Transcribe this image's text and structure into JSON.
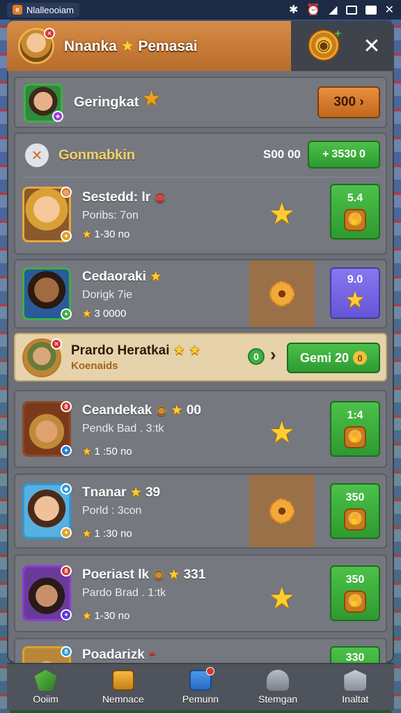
{
  "status_bar": {
    "app_title": "Nlalleooiam",
    "icons": [
      "bluetooth-icon",
      "alarm-icon",
      "signal-icon",
      "window-icon",
      "window-icon",
      "close-icon"
    ]
  },
  "header": {
    "title_part1": "Nnanka",
    "title_part2": "Pemasai",
    "close_symbol": "✕"
  },
  "top_row": {
    "name": "Geringkat",
    "button_label": "300",
    "button_arrow": "›"
  },
  "section": {
    "name": "Gonmabkin",
    "value": "S00 00",
    "button_label": "3530",
    "button_prefix": "+",
    "button_suffix": "0"
  },
  "players": [
    {
      "name": "Sestedd: lr",
      "sub": "Poribs: 7on",
      "meta": "1-30 no",
      "btn_value": "5.4",
      "btn_color": "green",
      "mid": "star"
    },
    {
      "name": "Cedaoraki",
      "sub": "Dorigk 7ie",
      "meta": "3 0000",
      "btn_value": "9.0",
      "btn_color": "purple",
      "mid": "gear"
    },
    {
      "name": "Ceandekak",
      "sub": "Pendk Bad . 3:tk",
      "meta": "1 :50 no",
      "btn_value": "1:4",
      "btn_color": "green",
      "mid": "star",
      "extra": "00"
    },
    {
      "name": "Tnanar",
      "sub": "Porld : 3con",
      "meta": "1 :30 no",
      "btn_value": "350",
      "btn_color": "green",
      "mid": "gear",
      "extra": "39"
    },
    {
      "name": "Poeriast lk",
      "sub": "Pardo Brad . 1:tk",
      "meta": "1-30 no",
      "btn_value": "350",
      "btn_color": "green",
      "mid": "star",
      "extra": "331"
    },
    {
      "name": "Poadarizk",
      "btn_value": "330",
      "btn_color": "green"
    }
  ],
  "highlight_row": {
    "name": "Prardo Heratkai",
    "sub": "Koenaids",
    "toggle_symbol": "0",
    "arrow": "›",
    "button_label": "Gemi 20",
    "button_suffix": "0"
  },
  "bottom_nav": [
    {
      "label": "Ooiim",
      "icon": "shield-icon"
    },
    {
      "label": "Nemnace",
      "icon": "trophy-icon"
    },
    {
      "label": "Pemunn",
      "icon": "calendar-icon"
    },
    {
      "label": "Stemgan",
      "icon": "helmet-icon"
    },
    {
      "label": "Inaltat",
      "icon": "building-icon"
    }
  ],
  "colors": {
    "header_orange": "#c7793a",
    "panel_gray": "#6b6f78",
    "row_gray": "#75787f",
    "highlight_row": "#e6d3ab",
    "green_button": "#3caf3c",
    "purple_button": "#7766e6",
    "star_gold": "#ffcd2f"
  }
}
